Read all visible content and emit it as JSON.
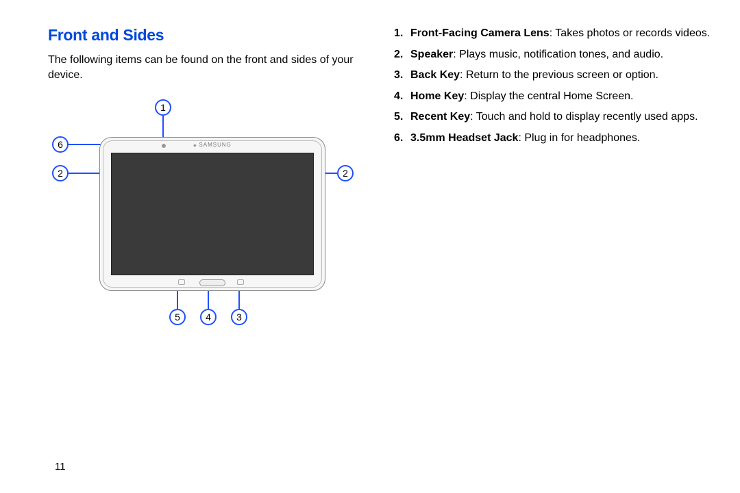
{
  "title": "Front and Sides",
  "intro": "The following items can be found on the front and sides of your device.",
  "brand": "SAMSUNG",
  "callouts": {
    "c1": "1",
    "c2a": "2",
    "c2b": "2",
    "c3": "3",
    "c4": "4",
    "c5": "5",
    "c6": "6"
  },
  "list": [
    {
      "term": "Front-Facing Camera Lens",
      "desc": ": Takes photos or records videos."
    },
    {
      "term": "Speaker",
      "desc": ": Plays music, notification tones, and audio."
    },
    {
      "term": "Back Key",
      "desc": ": Return to the previous screen or option."
    },
    {
      "term": "Home Key",
      "desc": ": Display the central Home Screen."
    },
    {
      "term": "Recent Key",
      "desc": ": Touch and hold to display recently used apps."
    },
    {
      "term": "3.5mm Headset Jack",
      "desc": ": Plug in for headphones."
    }
  ],
  "page_number": "11"
}
